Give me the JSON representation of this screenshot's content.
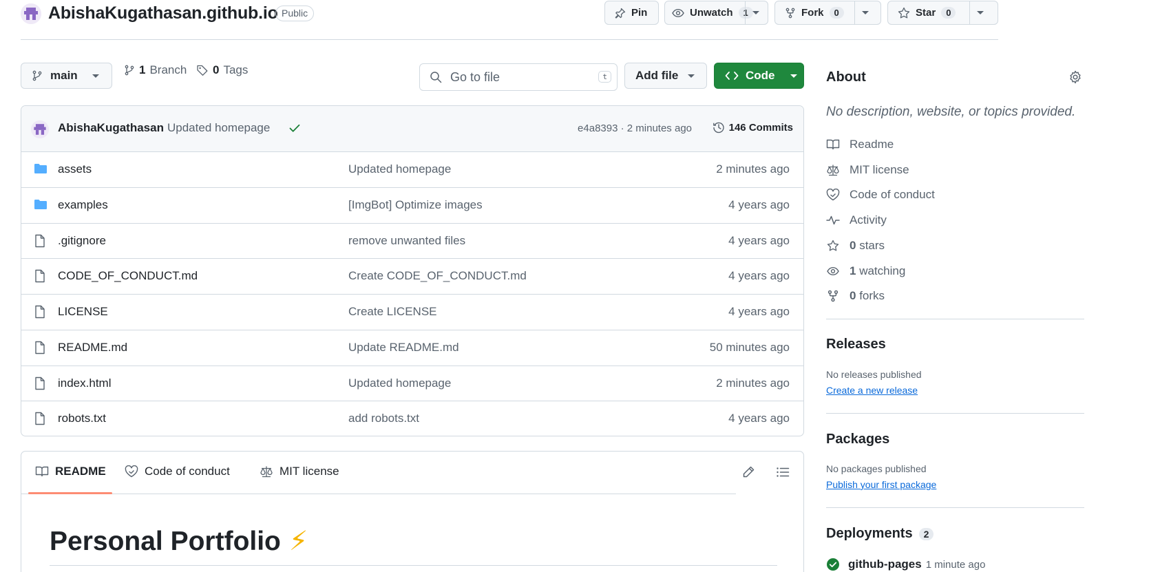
{
  "repo": {
    "name": "AbishaKugathasan.github.io",
    "visibility": "Public",
    "pin_label": "Pin",
    "unwatch_label": "Unwatch",
    "unwatch_count": "1",
    "fork_label": "Fork",
    "fork_count": "0",
    "star_label": "Star",
    "star_count": "0"
  },
  "toolbar": {
    "branch": "main",
    "branches_count": "1",
    "branches_label": "Branch",
    "tags_count": "0",
    "tags_label": "Tags",
    "search_placeholder": "Go to file",
    "search_key": "t",
    "add_file_label": "Add file",
    "code_label": "Code"
  },
  "latest_commit": {
    "author": "AbishaKugathasan",
    "message": "Updated homepage",
    "meta": "e4a8393 · 2 minutes ago",
    "commits_label": "146 Commits"
  },
  "files": [
    {
      "name": "assets",
      "type": "folder",
      "message": "Updated homepage",
      "age": "2 minutes ago"
    },
    {
      "name": "examples",
      "type": "folder",
      "message": "[ImgBot] Optimize images",
      "age": "4 years ago"
    },
    {
      "name": ".gitignore",
      "type": "file",
      "message": "remove unwanted files",
      "age": "4 years ago"
    },
    {
      "name": "CODE_OF_CONDUCT.md",
      "type": "file",
      "message": "Create CODE_OF_CONDUCT.md",
      "age": "4 years ago"
    },
    {
      "name": "LICENSE",
      "type": "file",
      "message": "Create LICENSE",
      "age": "4 years ago"
    },
    {
      "name": "README.md",
      "type": "file",
      "message": "Update README.md",
      "age": "50 minutes ago"
    },
    {
      "name": "index.html",
      "type": "file",
      "message": "Updated homepage",
      "age": "2 minutes ago"
    },
    {
      "name": "robots.txt",
      "type": "file",
      "message": "add robots.txt",
      "age": "4 years ago"
    }
  ],
  "readme": {
    "tabs": [
      "README",
      "Code of conduct",
      "MIT license"
    ],
    "heading": "Personal Portfolio",
    "heading_emoji": "⚡"
  },
  "about": {
    "title": "About",
    "description": "No description, website, or topics provided.",
    "readme": "Readme",
    "license": "MIT license",
    "conduct": "Code of conduct",
    "activity": "Activity",
    "stars_count": "0",
    "stars_label": "stars",
    "watching_count": "1",
    "watching_label": "watching",
    "forks_count": "0",
    "forks_label": "forks"
  },
  "releases": {
    "title": "Releases",
    "status": "No releases published",
    "link": "Create a new release"
  },
  "packages": {
    "title": "Packages",
    "status": "No packages published",
    "link": "Publish your first package"
  },
  "deployments": {
    "title": "Deployments",
    "count": "2",
    "env": "github-pages",
    "age": "1 minute ago"
  },
  "colors": {
    "accent_green": "#1f883d",
    "folder_blue": "#54aeff",
    "link_blue": "#0969da",
    "tab_underline": "#fd8c73"
  }
}
